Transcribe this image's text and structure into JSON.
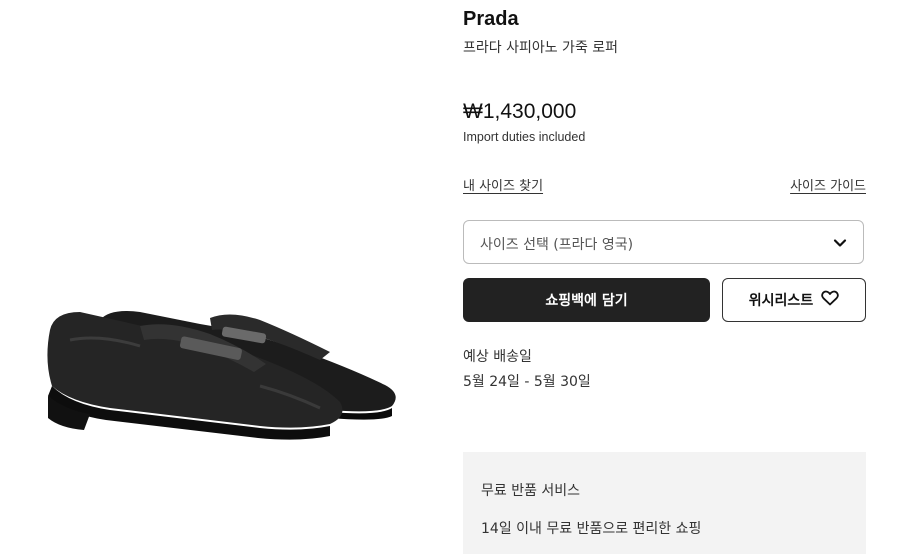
{
  "product": {
    "brand": "Prada",
    "name": "프라다 사피아노 가죽 로퍼",
    "price": "₩1,430,000",
    "duties_note": "Import duties included"
  },
  "size": {
    "find_my_size_link": "내 사이즈 찾기",
    "size_guide_link": "사이즈 가이드",
    "select_label": "사이즈 선택 (프라다 영국)"
  },
  "actions": {
    "add_to_bag": "쇼핑백에 담기",
    "wishlist": "위시리스트"
  },
  "delivery": {
    "label": "예상 배송일",
    "dates": "5월 24일 - 5월 30일"
  },
  "returns": {
    "title": "무료 반품 서비스",
    "description": "14일 이내 무료 반품으로 편리한 쇼핑"
  },
  "icons": {
    "select_chevron": "chevron-down-icon",
    "wishlist": "heart-icon"
  },
  "colors": {
    "primary_button": "#222222",
    "service_panel": "#f3f3f3"
  }
}
